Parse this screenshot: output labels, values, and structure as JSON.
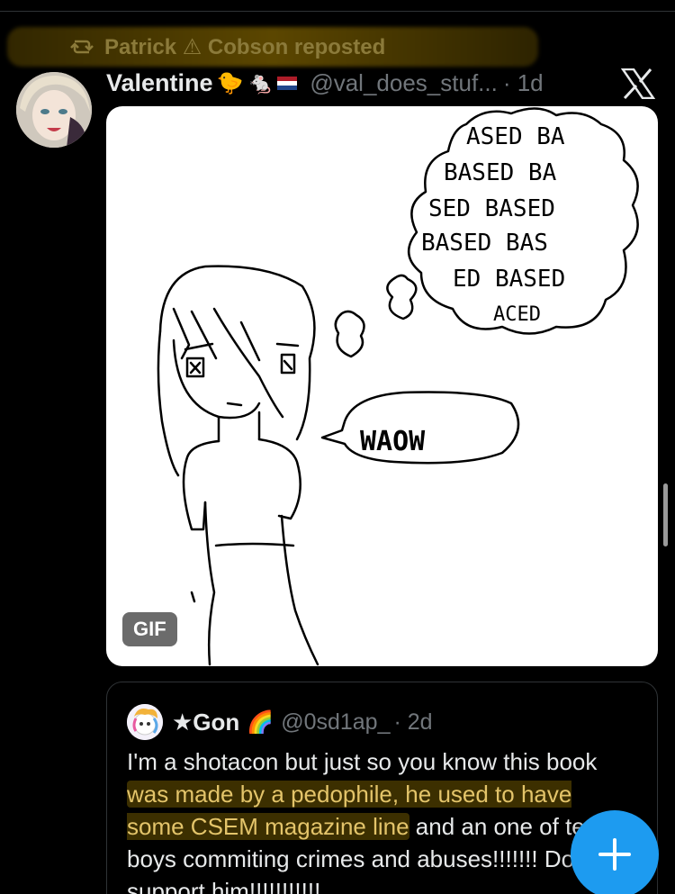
{
  "repost": {
    "text": "Patrick ⚠ Cobson reposted",
    "icon": "repost-icon"
  },
  "tweet": {
    "display_name": "Valentine",
    "name_emojis": [
      "🐤",
      "🐁",
      "🇳🇱"
    ],
    "handle": "@val_does_stuf...",
    "time": "· 1d",
    "menu_icon": "x-logo-icon"
  },
  "media": {
    "badge": "GIF",
    "drawing_texts": {
      "bubble_speech": "WAOW",
      "thought_line1": "ASED BA",
      "thought_line2": "BASED BA",
      "thought_line3": "SED BASED",
      "thought_line4": "BASED BAS",
      "thought_line5": "ED BASED",
      "thought_line6": "ACED"
    }
  },
  "quote": {
    "display_name": "★Gon",
    "name_emoji": "🌈",
    "handle": "@0sd1ap_",
    "time": "· 2d",
    "body_part1": "I'm a shotacon but just so you know this book ",
    "body_hl1": "was made by a pedophile, he used to have some CSEM magazine line",
    "body_part2": " and an",
    "body_part3": " one of teen boys commiting crimes and abuses!!!!!!! Don't support him!!!!!!!!!!!"
  },
  "colors": {
    "background": "#000000",
    "accent": "#1d9bf0",
    "highlight": "#e3c46a"
  },
  "fab": {
    "icon": "plus-icon"
  }
}
